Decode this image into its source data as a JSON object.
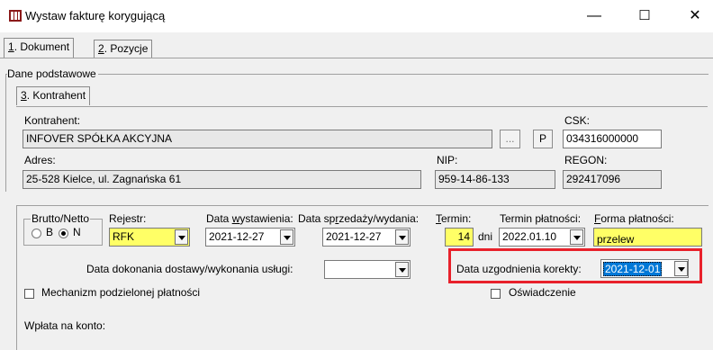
{
  "window": {
    "title": "Wystaw fakturę korygującą",
    "minimize_glyph": "—",
    "maximize_glyph": "☐",
    "close_glyph": "✕"
  },
  "tabs": {
    "dokument_prefix": "1",
    "dokument_label": ". Dokument",
    "pozycje_prefix": "2",
    "pozycje_label": ". Pozycje",
    "kontrahent_prefix": "3",
    "kontrahent_label": ". Kontrahent"
  },
  "dane_podstawowe": {
    "group_label": "Dane podstawowe",
    "kontrahent_label": "Kontrahent:",
    "kontrahent_value": "INFOVER  SPÓŁKA AKCYJNA",
    "ellipsis_button": "...",
    "p_button": "P",
    "csk_label": "CSK:",
    "csk_value": "034316000000",
    "adres_label": "Adres:",
    "adres_value": "25-528 Kielce, ul. Zagnańska 61",
    "nip_label": "NIP:",
    "nip_value": "959-14-86-133",
    "regon_label": "REGON:",
    "regon_value": "292417096"
  },
  "document": {
    "brutto_netto_label": "Brutto/Netto",
    "option_b": "B",
    "option_n": "N",
    "selected_option": "N",
    "rejestr_label": "Rejestr:",
    "rejestr_value": "RFK",
    "data_wyst_label_pre": "Data ",
    "data_wyst_label_u": "w",
    "data_wyst_label_post": "ystawienia:",
    "data_wyst_value": "2021-12-27",
    "data_sprz_label_pre": "Data sp",
    "data_sprz_label_u": "r",
    "data_sprz_label_post": "zedaży/wydania:",
    "data_sprz_value": "2021-12-27",
    "termin_label_u": "T",
    "termin_label_post": "ermin:",
    "termin_value": "14",
    "dni_label": "dni",
    "termin_platnosci_label": "Termin płatności:",
    "termin_platnosci_value": "2022.01.10",
    "forma_platnosci_label_u": "F",
    "forma_platnosci_label_post": "orma płatności:",
    "forma_platnosci_value": "przelew",
    "data_dokonania_label": "Data dokonania dostawy/wykonania usługi:",
    "data_dokonania_value": "",
    "data_uzgodnienia_label": "Data uzgodnienia korekty:",
    "data_uzgodnienia_value": "2021-12-01",
    "mechanizm_label": "Mechanizm podzielonej płatności",
    "oswiadczenie_label": "Oświadczenie",
    "wplata_label": "Wpłata na konto:"
  }
}
